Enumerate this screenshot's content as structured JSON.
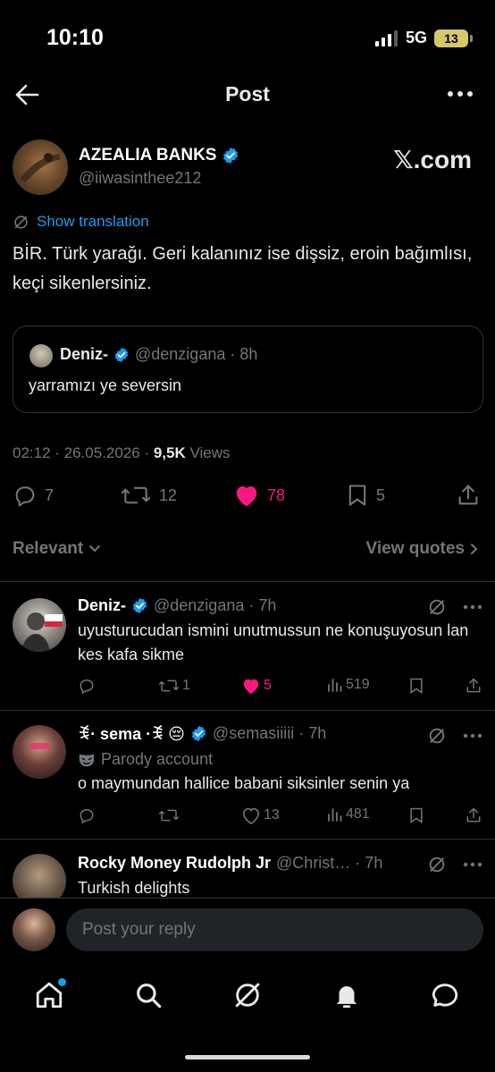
{
  "status_bar": {
    "time": "10:10",
    "network": "5G",
    "battery": "13"
  },
  "header": {
    "title": "Post"
  },
  "post": {
    "author_name": "AZEALIA BANKS",
    "author_handle": "@iiwasinthee212",
    "watermark": "𝕏.com",
    "translation_label": "Show translation",
    "text": "BİR. Türk yarağı. Geri kalanınız ise dişsiz, eroin bağımlısı, keçi sikenlersiniz.",
    "quote": {
      "name": "Deniz-",
      "handle_time": "@denzigana · 8h",
      "text": "yarramızı ye seversin"
    },
    "timestamp": "02:12 · 26.05.2026 · ",
    "views_count": "9,5K",
    "views_label": " Views",
    "stats": {
      "replies": "7",
      "reposts": "12",
      "likes": "78",
      "bookmarks": "5"
    },
    "colors": {
      "like": "#f91880",
      "verified": "#1d9bf0"
    }
  },
  "sort": {
    "relevant_label": "Relevant",
    "view_quotes_label": "View quotes"
  },
  "replies": [
    {
      "name": "Deniz-",
      "handle_time": "@denzigana · 7h",
      "text": "uyusturucudan ismini unutmussun ne konuşuyosun lan kes kafa sikme",
      "reposts": "1",
      "likes": "5",
      "views": "519"
    },
    {
      "name": "ꉂ· sema ·ꉂ 😔",
      "handle_time": "@semasiiiii · 7h",
      "parody_label": "Parody account",
      "text": "o maymundan hallice babani siksinler senin ya",
      "likes": "13",
      "views": "481"
    },
    {
      "name": "Rocky Money Rudolph Jr",
      "handle_time": "@Christ… · 7h",
      "text": "Turkish delights"
    }
  ],
  "composer": {
    "placeholder": "Post your reply"
  }
}
